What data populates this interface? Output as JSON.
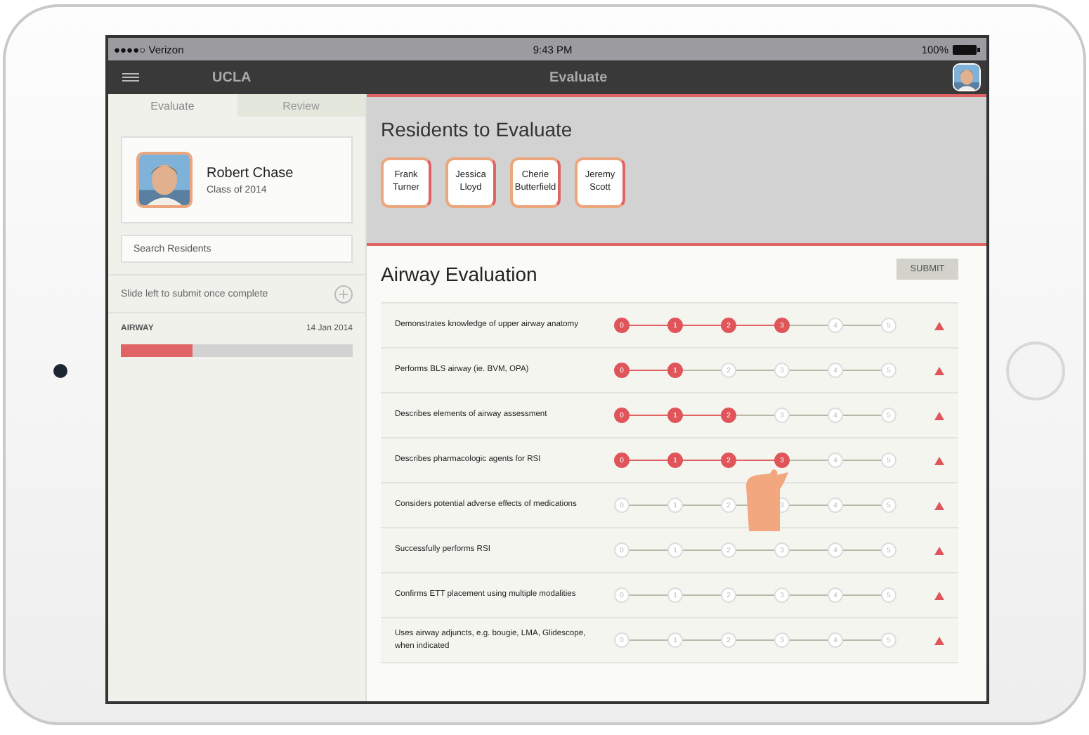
{
  "status_bar": {
    "carrier": "●●●●○ Verizon",
    "time": "9:43 PM",
    "battery": "100%"
  },
  "nav_bar": {
    "brand": "UCLA",
    "title": "Evaluate"
  },
  "sidebar": {
    "tabs": [
      {
        "label": "Evaluate",
        "selected": true
      },
      {
        "label": "Review",
        "selected": false
      }
    ],
    "profile": {
      "name": "Robert Chase",
      "subtitle": "Class of 2014"
    },
    "search": {
      "placeholder": "Search Residents"
    },
    "hint": "Slide left to submit once complete",
    "evaluations": [
      {
        "title": "AIRWAY",
        "date": "14 Jan 2014",
        "level": 0.31
      }
    ]
  },
  "residents": {
    "title": "Residents to Evaluate",
    "items": [
      {
        "first": "Frank",
        "last": "Turner"
      },
      {
        "first": "Jessica",
        "last": "Lloyd"
      },
      {
        "first": "Cherie",
        "last": "Butterfield"
      },
      {
        "first": "Jeremy",
        "last": "Scott"
      }
    ]
  },
  "evaluation": {
    "title": "Airway Evaluation",
    "submit": "SUBMIT",
    "rows": [
      {
        "label": "Demonstrates knowledge of upper airway anatomy",
        "points": [
          {
            "label": "0",
            "selected": true
          },
          {
            "label": "1",
            "selected": true
          },
          {
            "label": "2",
            "selected": true
          },
          {
            "label": "3",
            "selected": true
          },
          {
            "label": "4",
            "selected": false
          },
          {
            "label": "5",
            "selected": false
          }
        ]
      },
      {
        "label": "Performs BLS airway (ie. BVM, OPA)",
        "points": [
          {
            "label": "0",
            "selected": true
          },
          {
            "label": "1",
            "selected": true
          },
          {
            "label": "2",
            "selected": false
          },
          {
            "label": "3",
            "selected": false
          },
          {
            "label": "4",
            "selected": false
          },
          {
            "label": "5",
            "selected": false
          }
        ]
      },
      {
        "label": "Describes elements of airway assessment",
        "points": [
          {
            "label": "0",
            "selected": true
          },
          {
            "label": "1",
            "selected": true
          },
          {
            "label": "2",
            "selected": true
          },
          {
            "label": "3",
            "selected": false
          },
          {
            "label": "4",
            "selected": false
          },
          {
            "label": "5",
            "selected": false
          }
        ]
      },
      {
        "label": "Describes pharmacologic agents for RSI",
        "points": [
          {
            "label": "0",
            "selected": true
          },
          {
            "label": "1",
            "selected": true
          },
          {
            "label": "2",
            "selected": true
          },
          {
            "label": "3",
            "selected": true
          },
          {
            "label": "4",
            "selected": false
          },
          {
            "label": "5",
            "selected": false
          }
        ]
      },
      {
        "label": "Considers potential adverse effects of medications",
        "points": [
          {
            "label": "0",
            "selected": false
          },
          {
            "label": "1",
            "selected": false
          },
          {
            "label": "2",
            "selected": false
          },
          {
            "label": "3",
            "selected": false
          },
          {
            "label": "4",
            "selected": false
          },
          {
            "label": "5",
            "selected": false
          }
        ]
      },
      {
        "label": "Successfully performs RSI",
        "points": [
          {
            "label": "0",
            "selected": false
          },
          {
            "label": "1",
            "selected": false
          },
          {
            "label": "2",
            "selected": false
          },
          {
            "label": "3",
            "selected": false
          },
          {
            "label": "4",
            "selected": false
          },
          {
            "label": "5",
            "selected": false
          }
        ]
      },
      {
        "label": "Confirms ETT placement using multiple modalities",
        "points": [
          {
            "label": "0",
            "selected": false
          },
          {
            "label": "1",
            "selected": false
          },
          {
            "label": "2",
            "selected": false
          },
          {
            "label": "3",
            "selected": false
          },
          {
            "label": "4",
            "selected": false
          },
          {
            "label": "5",
            "selected": false
          }
        ]
      },
      {
        "label": "Uses airway adjuncts, e.g. bougie, LMA, Glidescope, when indicated",
        "points": [
          {
            "label": "0",
            "selected": false
          },
          {
            "label": "1",
            "selected": false
          },
          {
            "label": "2",
            "selected": false
          },
          {
            "label": "3",
            "selected": false
          },
          {
            "label": "4",
            "selected": false
          },
          {
            "label": "5",
            "selected": false
          }
        ]
      }
    ]
  }
}
